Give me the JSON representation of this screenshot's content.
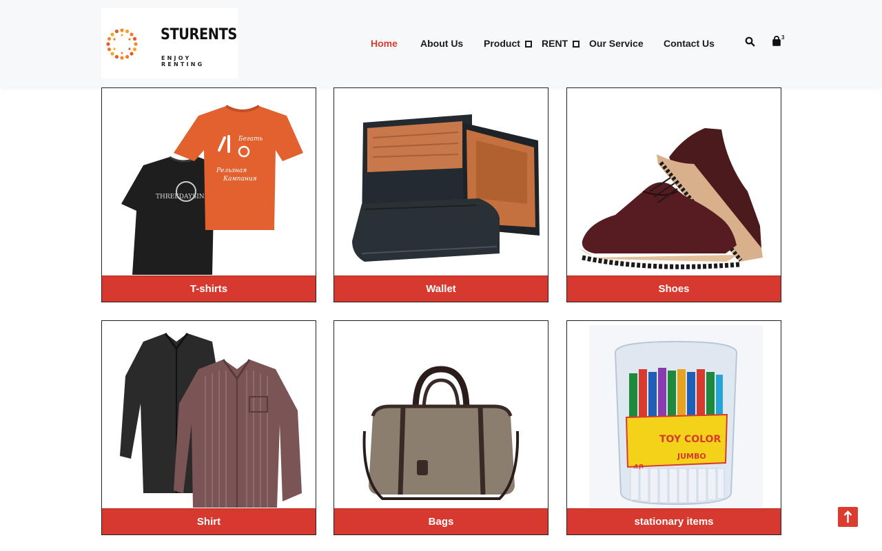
{
  "brand": {
    "name": "STURENTS",
    "tagline": "ENJOY RENTING"
  },
  "nav": {
    "items": [
      {
        "label": "Home",
        "active": true
      },
      {
        "label": "About Us"
      },
      {
        "label": "Product",
        "dropdown": true
      },
      {
        "label": "RENT",
        "dropdown": true
      },
      {
        "label": "Our Service"
      },
      {
        "label": "Contact Us"
      }
    ]
  },
  "header_icons": {
    "search": "search-icon",
    "cart": "shopping-bag-icon",
    "cart_count": "3"
  },
  "categories": [
    {
      "label": "T-shirts",
      "image": "tshirts-image"
    },
    {
      "label": "Wallet",
      "image": "wallet-image"
    },
    {
      "label": "Shoes",
      "image": "shoes-image"
    },
    {
      "label": "Shirt",
      "image": "shirts-image"
    },
    {
      "label": "Bags",
      "image": "bag-image"
    },
    {
      "label": "stationary items",
      "image": "markers-image"
    }
  ],
  "colors": {
    "accent": "#d8392f",
    "header_bg": "#f6f8fa"
  },
  "scroll_top": {
    "icon": "arrow-up-icon"
  }
}
